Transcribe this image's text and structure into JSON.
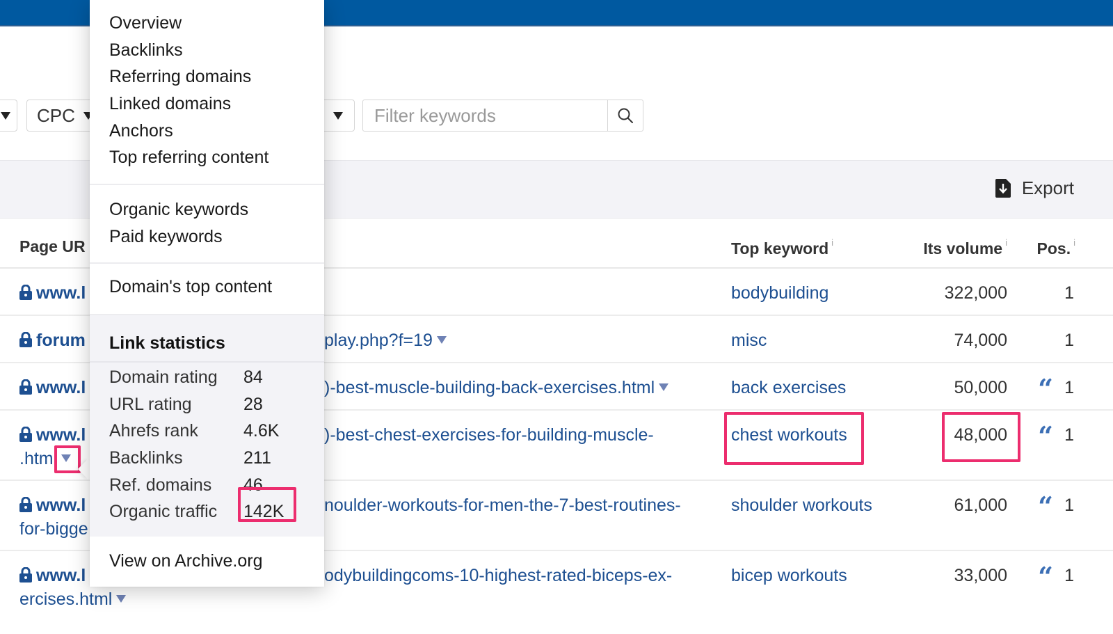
{
  "colors": {
    "topbar": "#0059a0",
    "link": "#1d4f91",
    "highlight": "#ec2d6e"
  },
  "filters": {
    "cpc_label": "CPC",
    "search_placeholder": "Filter keywords",
    "search_value": ""
  },
  "toolbar": {
    "export_label": "Export"
  },
  "table": {
    "headers": {
      "url": "Page UR",
      "keyword": "Top keyword",
      "volume": "Its volume",
      "position": "Pos.",
      "info": "i"
    },
    "rows": [
      {
        "domain": "www.l",
        "url_cont": "",
        "path": "",
        "keyword": "bodybuilding",
        "volume": "322,000",
        "quote": false,
        "position": "1"
      },
      {
        "domain": "forum",
        "url_cont": "",
        "path": "play.php?f=19",
        "keyword": "misc",
        "volume": "74,000",
        "quote": false,
        "position": "1"
      },
      {
        "domain": "www.l",
        "url_cont": "",
        "path": ")-best-muscle-building-back-exercises.html",
        "keyword": "back exercises",
        "volume": "50,000",
        "quote": true,
        "position": "1"
      },
      {
        "domain": "www.l",
        "url_cont": ".html",
        "path": ")-best-chest-exercises-for-building-muscle-",
        "keyword": "chest workouts",
        "volume": "48,000",
        "quote": true,
        "position": "1"
      },
      {
        "domain": "www.l",
        "url_cont": "for-bigge",
        "path": "noulder-workouts-for-men-the-7-best-routines-",
        "keyword": "shoulder workouts",
        "volume": "61,000",
        "quote": true,
        "position": "1"
      },
      {
        "domain": "www.l",
        "url_cont": "ercises.html",
        "path": "odybuildingcoms-10-highest-rated-biceps-ex-",
        "keyword": "bicep workouts",
        "volume": "33,000",
        "quote": true,
        "position": "1"
      }
    ]
  },
  "dropdown": {
    "group1": [
      "Overview",
      "Backlinks",
      "Referring domains",
      "Linked domains",
      "Anchors",
      "Top referring content"
    ],
    "group2": [
      "Organic keywords",
      "Paid keywords"
    ],
    "group3": [
      "Domain's top content"
    ],
    "stats_title": "Link statistics",
    "stats": [
      {
        "label": "Domain rating",
        "value": "84"
      },
      {
        "label": "URL rating",
        "value": "28"
      },
      {
        "label": "Ahrefs rank",
        "value": "4.6K"
      },
      {
        "label": "Backlinks",
        "value": "211"
      },
      {
        "label": "Ref. domains",
        "value": "46"
      },
      {
        "label": "Organic traffic",
        "value": "142K"
      }
    ],
    "archive_label": "View on Archive.org"
  }
}
